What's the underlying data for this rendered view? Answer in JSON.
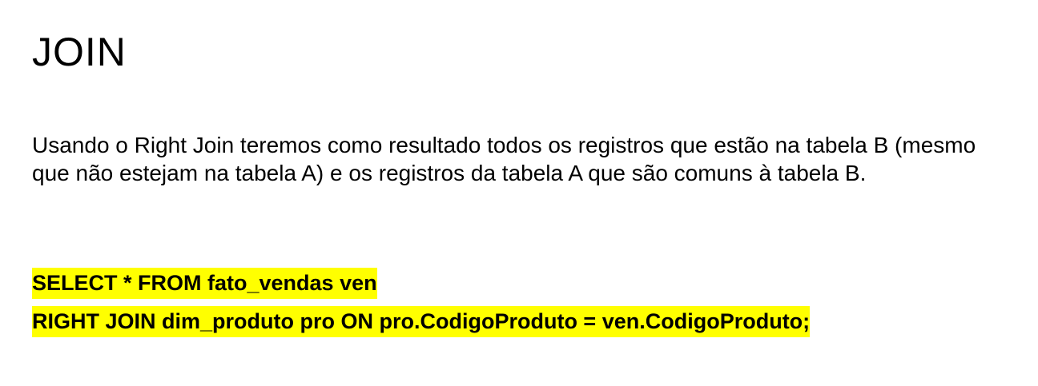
{
  "slide": {
    "title": "JOIN",
    "paragraph": "Usando o Right Join teremos como resultado todos os registros que estão na tabela B (mesmo que não estejam na tabela A) e os registros da tabela A que são comuns à tabela B.",
    "code_lines": [
      "SELECT * FROM fato_vendas ven",
      "RIGHT JOIN dim_produto pro ON pro.CodigoProduto = ven.CodigoProduto;"
    ],
    "highlight_color": "#ffff00"
  }
}
